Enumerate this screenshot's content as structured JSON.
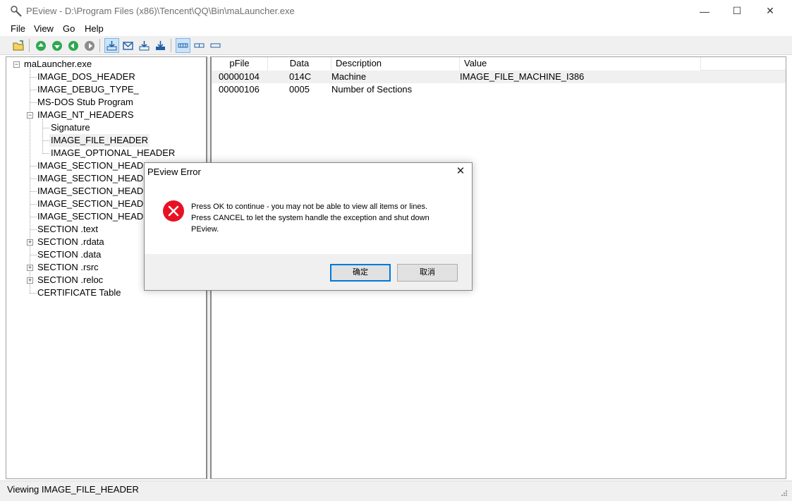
{
  "window": {
    "title": "PEview - D:\\Program Files (x86)\\Tencent\\QQ\\Bin\\maLauncher.exe",
    "controls": {
      "minimize": "—",
      "maximize": "☐",
      "close": "✕"
    }
  },
  "menu": {
    "items": [
      "File",
      "View",
      "Go",
      "Help"
    ]
  },
  "toolbar": {
    "buttons": [
      "open-file",
      "go-up",
      "go-down",
      "go-back",
      "go-forward",
      "view-byte",
      "view-word",
      "view-dword",
      "view-qword",
      "view-details",
      "view-list",
      "view-small"
    ]
  },
  "tree": {
    "root": "maLauncher.exe",
    "items": [
      "IMAGE_DOS_HEADER",
      "IMAGE_DEBUG_TYPE_",
      "MS-DOS Stub Program",
      "IMAGE_NT_HEADERS",
      "Signature",
      "IMAGE_FILE_HEADER",
      "IMAGE_OPTIONAL_HEADER",
      "IMAGE_SECTION_HEADER .text",
      "IMAGE_SECTION_HEADER .rdata",
      "IMAGE_SECTION_HEADER .data",
      "IMAGE_SECTION_HEADER .rsrc",
      "IMAGE_SECTION_HEADER .reloc",
      "SECTION .text",
      "SECTION .rdata",
      "SECTION .data",
      "SECTION .rsrc",
      "SECTION .reloc",
      "CERTIFICATE Table"
    ],
    "expand_symbols": {
      "collapsed": "+",
      "expanded": "−"
    }
  },
  "grid": {
    "columns": [
      "pFile",
      "Data",
      "Description",
      "Value"
    ],
    "rows": [
      [
        "00000104",
        "014C",
        "Machine",
        "IMAGE_FILE_MACHINE_I386"
      ],
      [
        "00000106",
        "0005",
        "Number of Sections",
        ""
      ]
    ]
  },
  "status": {
    "text": "Viewing IMAGE_FILE_HEADER"
  },
  "dialog": {
    "title": "PEview Error",
    "close": "✕",
    "message": [
      "Press OK to continue - you may not be able to view all items or lines.",
      "Press CANCEL to let the system handle the exception and shut down",
      "PEview."
    ],
    "ok_label": "确定",
    "cancel_label": "取消"
  },
  "colors": {
    "error_red": "#e81123",
    "selection_blue": "#0078d7"
  }
}
